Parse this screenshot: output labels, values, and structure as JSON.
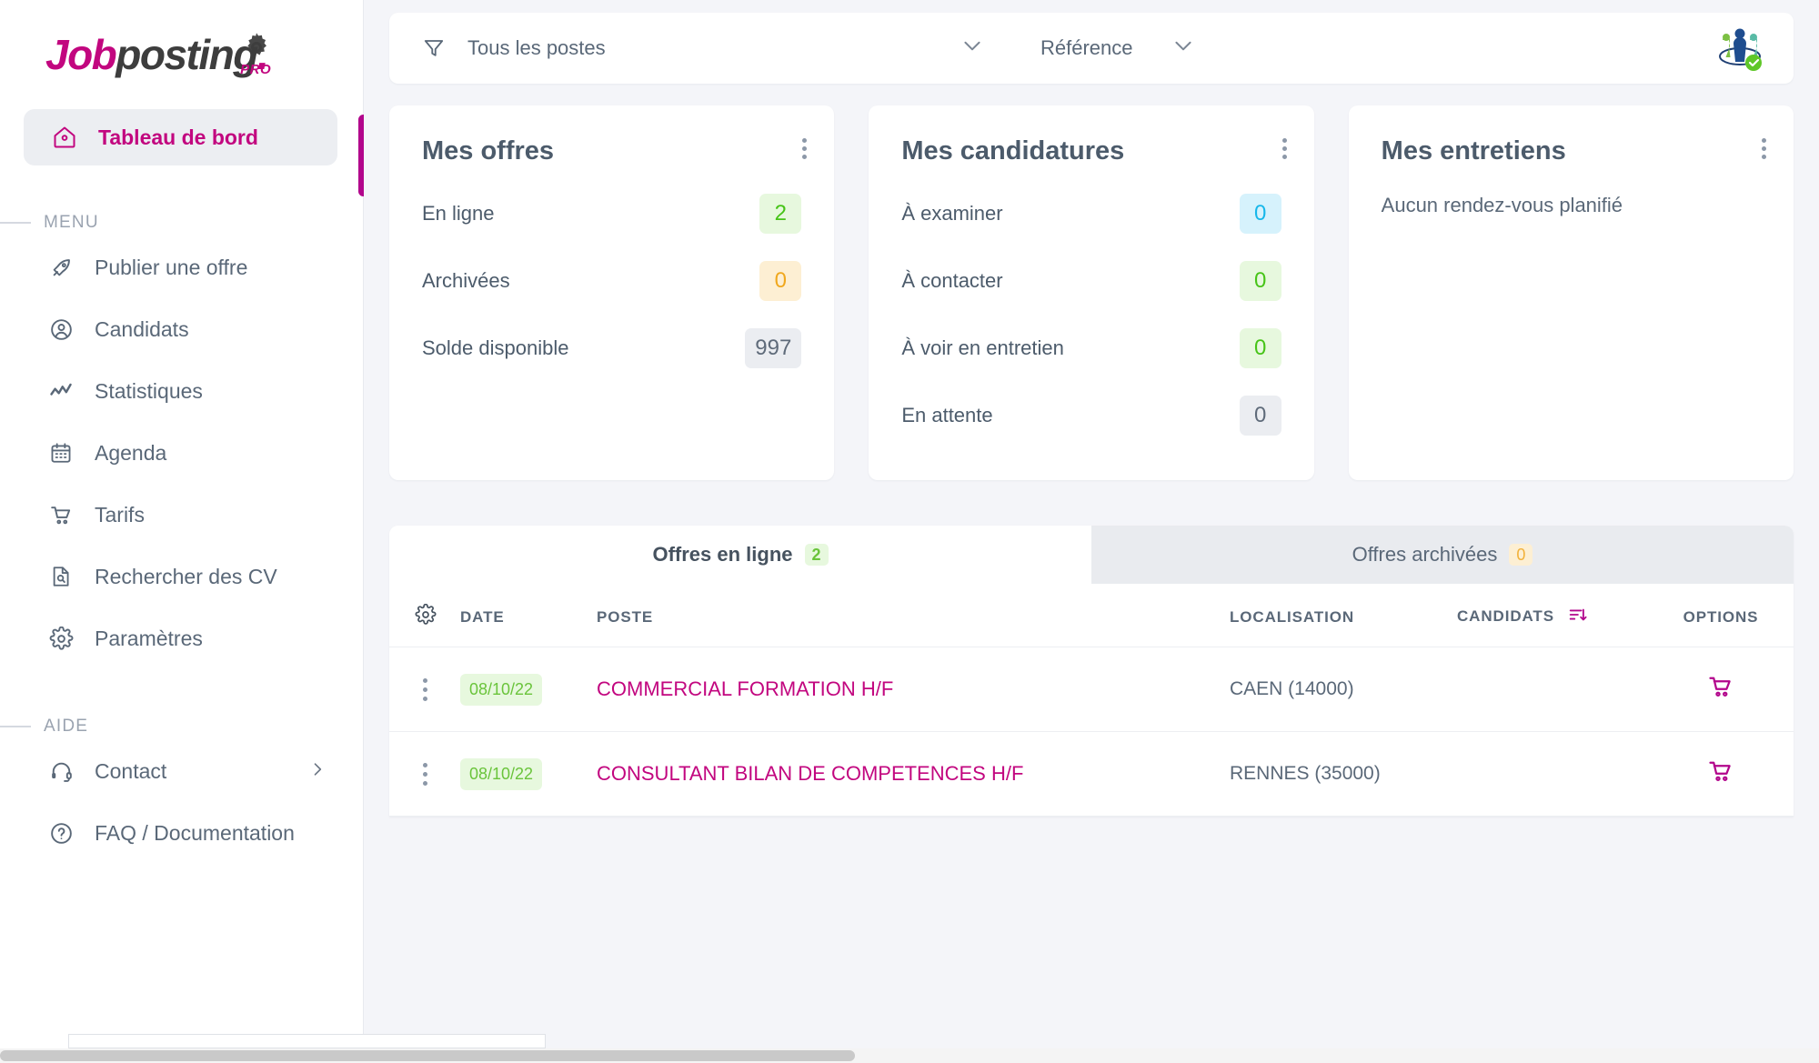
{
  "brand": {
    "logo_part1": "Job",
    "logo_part2": "posting",
    "logo_dot": ".",
    "logo_pro": "PRO",
    "accent_magenta": "#c2067f",
    "accent_indicator": "#b2068c",
    "text_slate": "#5a6878"
  },
  "sidebar": {
    "active_item": {
      "label": "Tableau de bord",
      "icon": "home-icon"
    },
    "menu_section_label": "MENU",
    "menu_items": [
      {
        "label": "Publier une offre",
        "icon": "rocket-icon"
      },
      {
        "label": "Candidats",
        "icon": "user-circle-icon"
      },
      {
        "label": "Statistiques",
        "icon": "activity-chart-icon"
      },
      {
        "label": "Agenda",
        "icon": "calendar-icon"
      },
      {
        "label": "Tarifs",
        "icon": "shopping-cart-icon"
      },
      {
        "label": "Rechercher des CV",
        "icon": "document-search-icon"
      },
      {
        "label": "Paramètres",
        "icon": "gear-icon"
      }
    ],
    "help_section_label": "AIDE",
    "help_items": [
      {
        "label": "Contact",
        "icon": "headset-icon",
        "has_chevron": true
      },
      {
        "label": "FAQ / Documentation",
        "icon": "question-circle-icon",
        "has_chevron": false
      }
    ]
  },
  "topbar": {
    "filter_icon": "filter-icon",
    "filter_value": "Tous les postes",
    "sort_value": "Référence",
    "avatar_icon": "company-people-logo",
    "status_dot_color": "#5fc728"
  },
  "cards": [
    {
      "title": "Mes offres",
      "menu_icon": "kebab-menu-icon",
      "rows": [
        {
          "label": "En ligne",
          "value": "2",
          "style": "green"
        },
        {
          "label": "Archivées",
          "value": "0",
          "style": "orange"
        },
        {
          "label": "Solde disponible",
          "value": "997",
          "style": "grey"
        }
      ]
    },
    {
      "title": "Mes candidatures",
      "menu_icon": "kebab-menu-icon",
      "rows": [
        {
          "label": "À examiner",
          "value": "0",
          "style": "blue"
        },
        {
          "label": "À contacter",
          "value": "0",
          "style": "green"
        },
        {
          "label": "À voir en entretien",
          "value": "0",
          "style": "green"
        },
        {
          "label": "En attente",
          "value": "0",
          "style": "grey"
        }
      ]
    },
    {
      "title": "Mes entretiens",
      "menu_icon": "kebab-menu-icon",
      "empty_message": "Aucun rendez-vous planifié",
      "rows": []
    }
  ],
  "offers_panel": {
    "tabs": [
      {
        "label": "Offres en ligne",
        "badge": "2",
        "badge_style": "green",
        "active": true
      },
      {
        "label": "Offres archivées",
        "badge": "0",
        "badge_style": "orange",
        "active": false
      }
    ],
    "columns": {
      "settings_icon": "gear-icon",
      "date": "DATE",
      "poste": "POSTE",
      "localisation": "LOCALISATION",
      "candidats": "CANDIDATS",
      "candidats_sort_icon": "sort-descending-icon",
      "options": "OPTIONS"
    },
    "rows": [
      {
        "row_menu_icon": "kebab-menu-icon",
        "date": "08/10/22",
        "poste": "COMMERCIAL FORMATION H/F",
        "localisation": "CAEN (14000)",
        "candidats": "",
        "option_icon": "shopping-cart-icon"
      },
      {
        "row_menu_icon": "kebab-menu-icon",
        "date": "08/10/22",
        "poste": "CONSULTANT BILAN DE COMPETENCES H/F",
        "localisation": "RENNES (35000)",
        "candidats": "",
        "option_icon": "shopping-cart-icon"
      }
    ]
  }
}
